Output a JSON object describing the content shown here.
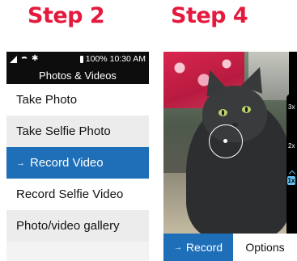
{
  "steps": {
    "left_title": "Step 2",
    "right_title": "Step 4"
  },
  "status_bar": {
    "battery": "100%",
    "time": "10:30 AM"
  },
  "screen_left": {
    "header_title": "Photos & Videos",
    "menu": [
      {
        "label": "Take Photo",
        "selected": false
      },
      {
        "label": "Take Selfie Photo",
        "selected": false
      },
      {
        "label": "Record Video",
        "selected": true
      },
      {
        "label": "Record Selfie Video",
        "selected": false
      },
      {
        "label": "Photo/video gallery",
        "selected": false
      }
    ],
    "selection_arrow": "→"
  },
  "screen_right": {
    "zoom_levels": [
      "3x",
      "2x",
      "1x"
    ],
    "selected_zoom": "1x",
    "softkeys": {
      "left": "Record",
      "right": "Options"
    },
    "softkey_arrow": "→"
  },
  "colors": {
    "step_title": "#e5193e",
    "selection": "#1f6fb8",
    "zoom_accent": "#5fc1f0",
    "header_bg": "#0d0d0d"
  },
  "icons": [
    "signal-icon",
    "wifi-icon",
    "bluetooth-icon",
    "battery-icon",
    "arrow-right-icon",
    "focus-ring-icon",
    "chevron-up-icon"
  ]
}
